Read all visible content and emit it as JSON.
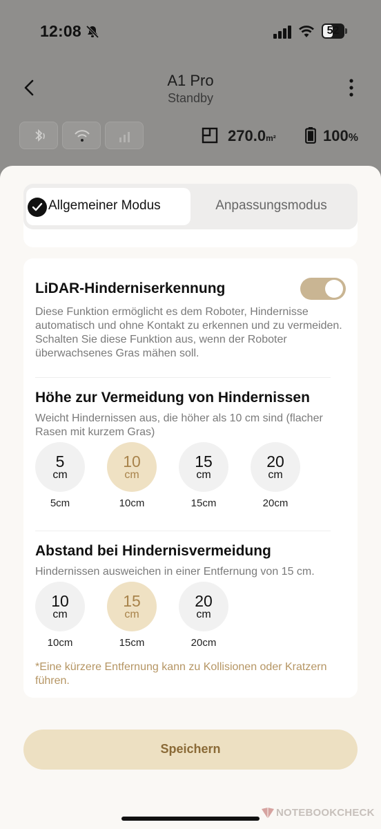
{
  "status_bar": {
    "time": "12:08",
    "battery_level": "52"
  },
  "header": {
    "title": "A1 Pro",
    "subtitle": "Standby"
  },
  "robot_info": {
    "area_value": "270.0",
    "area_unit": "m²",
    "battery_value": "100",
    "battery_unit": "%"
  },
  "mode_tabs": {
    "active": "Allgemeiner Modus",
    "inactive": "Anpassungsmodus"
  },
  "lidar": {
    "title": "LiDAR-Hinderniserkennung",
    "description": "Diese Funktion ermöglicht es dem Roboter, Hindernisse automatisch und ohne Kontakt zu erkennen und zu vermeiden. Schalten Sie diese Funktion aus, wenn der Roboter überwachsenes Gras mähen soll.",
    "enabled": true
  },
  "height": {
    "title": "Höhe zur Vermeidung von Hindernissen",
    "description": "Weicht Hindernissen aus, die höher als 10 cm sind (flacher Rasen mit kurzem Gras)",
    "options": [
      {
        "num": "5",
        "unit": "cm",
        "label": "5cm",
        "selected": false
      },
      {
        "num": "10",
        "unit": "cm",
        "label": "10cm",
        "selected": true
      },
      {
        "num": "15",
        "unit": "cm",
        "label": "15cm",
        "selected": false
      },
      {
        "num": "20",
        "unit": "cm",
        "label": "20cm",
        "selected": false
      }
    ]
  },
  "distance": {
    "title": "Abstand bei Hindernisvermeidung",
    "description": "Hindernissen ausweichen in einer Entfernung von 15 cm.",
    "options": [
      {
        "num": "10",
        "unit": "cm",
        "label": "10cm",
        "selected": false
      },
      {
        "num": "15",
        "unit": "cm",
        "label": "15cm",
        "selected": true
      },
      {
        "num": "20",
        "unit": "cm",
        "label": "20cm",
        "selected": false
      }
    ],
    "note": "*Eine kürzere Entfernung kann zu Kollisionen oder Kratzern führen."
  },
  "save_label": "Speichern",
  "watermark": "NOTEBOOKCHECK",
  "colors": {
    "accent": "#c9b593",
    "accent_light": "#efe1c3",
    "accent_text": "#a8834b",
    "button_bg": "#ede0c2"
  }
}
